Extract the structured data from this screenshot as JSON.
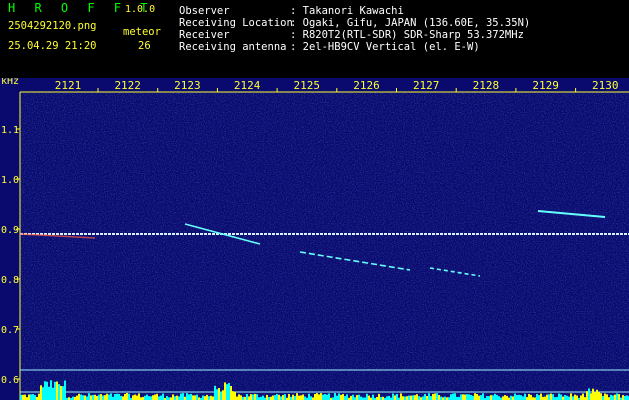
{
  "app": {
    "title": "H R O F F T",
    "version": "1.0.0",
    "filename": "2504292120.png",
    "datetime": "25.04.29 21:20",
    "meteor_label": "meteor",
    "meteor_count": "26"
  },
  "info": [
    {
      "label": "Observer",
      "value": ": Takanori Kawachi"
    },
    {
      "label": "Receiving Location",
      "value": ": Ogaki, Gifu, JAPAN (136.60E, 35.35N)"
    },
    {
      "label": "Receiver",
      "value": ": R820T2(RTL-SDR) SDR-Sharp 53.372MHz"
    },
    {
      "label": "Receiving antenna",
      "value": ": 2el-HB9CV Vertical (el. E-W)"
    }
  ],
  "spectrogram": {
    "unit_label": "kHz",
    "time_ticks": [
      "2121",
      "2122",
      "2123",
      "2124",
      "2125",
      "2126",
      "2127",
      "2128",
      "2129",
      "2130"
    ],
    "freq_ticks": [
      "1.1",
      "1.0",
      "0.9",
      "0.8",
      "0.7",
      "0.6"
    ],
    "colors": {
      "background": "#0a0a6e",
      "axis": "#ffff33",
      "carrier": "#d9f2ff",
      "echo": "#66ffff",
      "baseline": "#9ff3ff"
    }
  }
}
